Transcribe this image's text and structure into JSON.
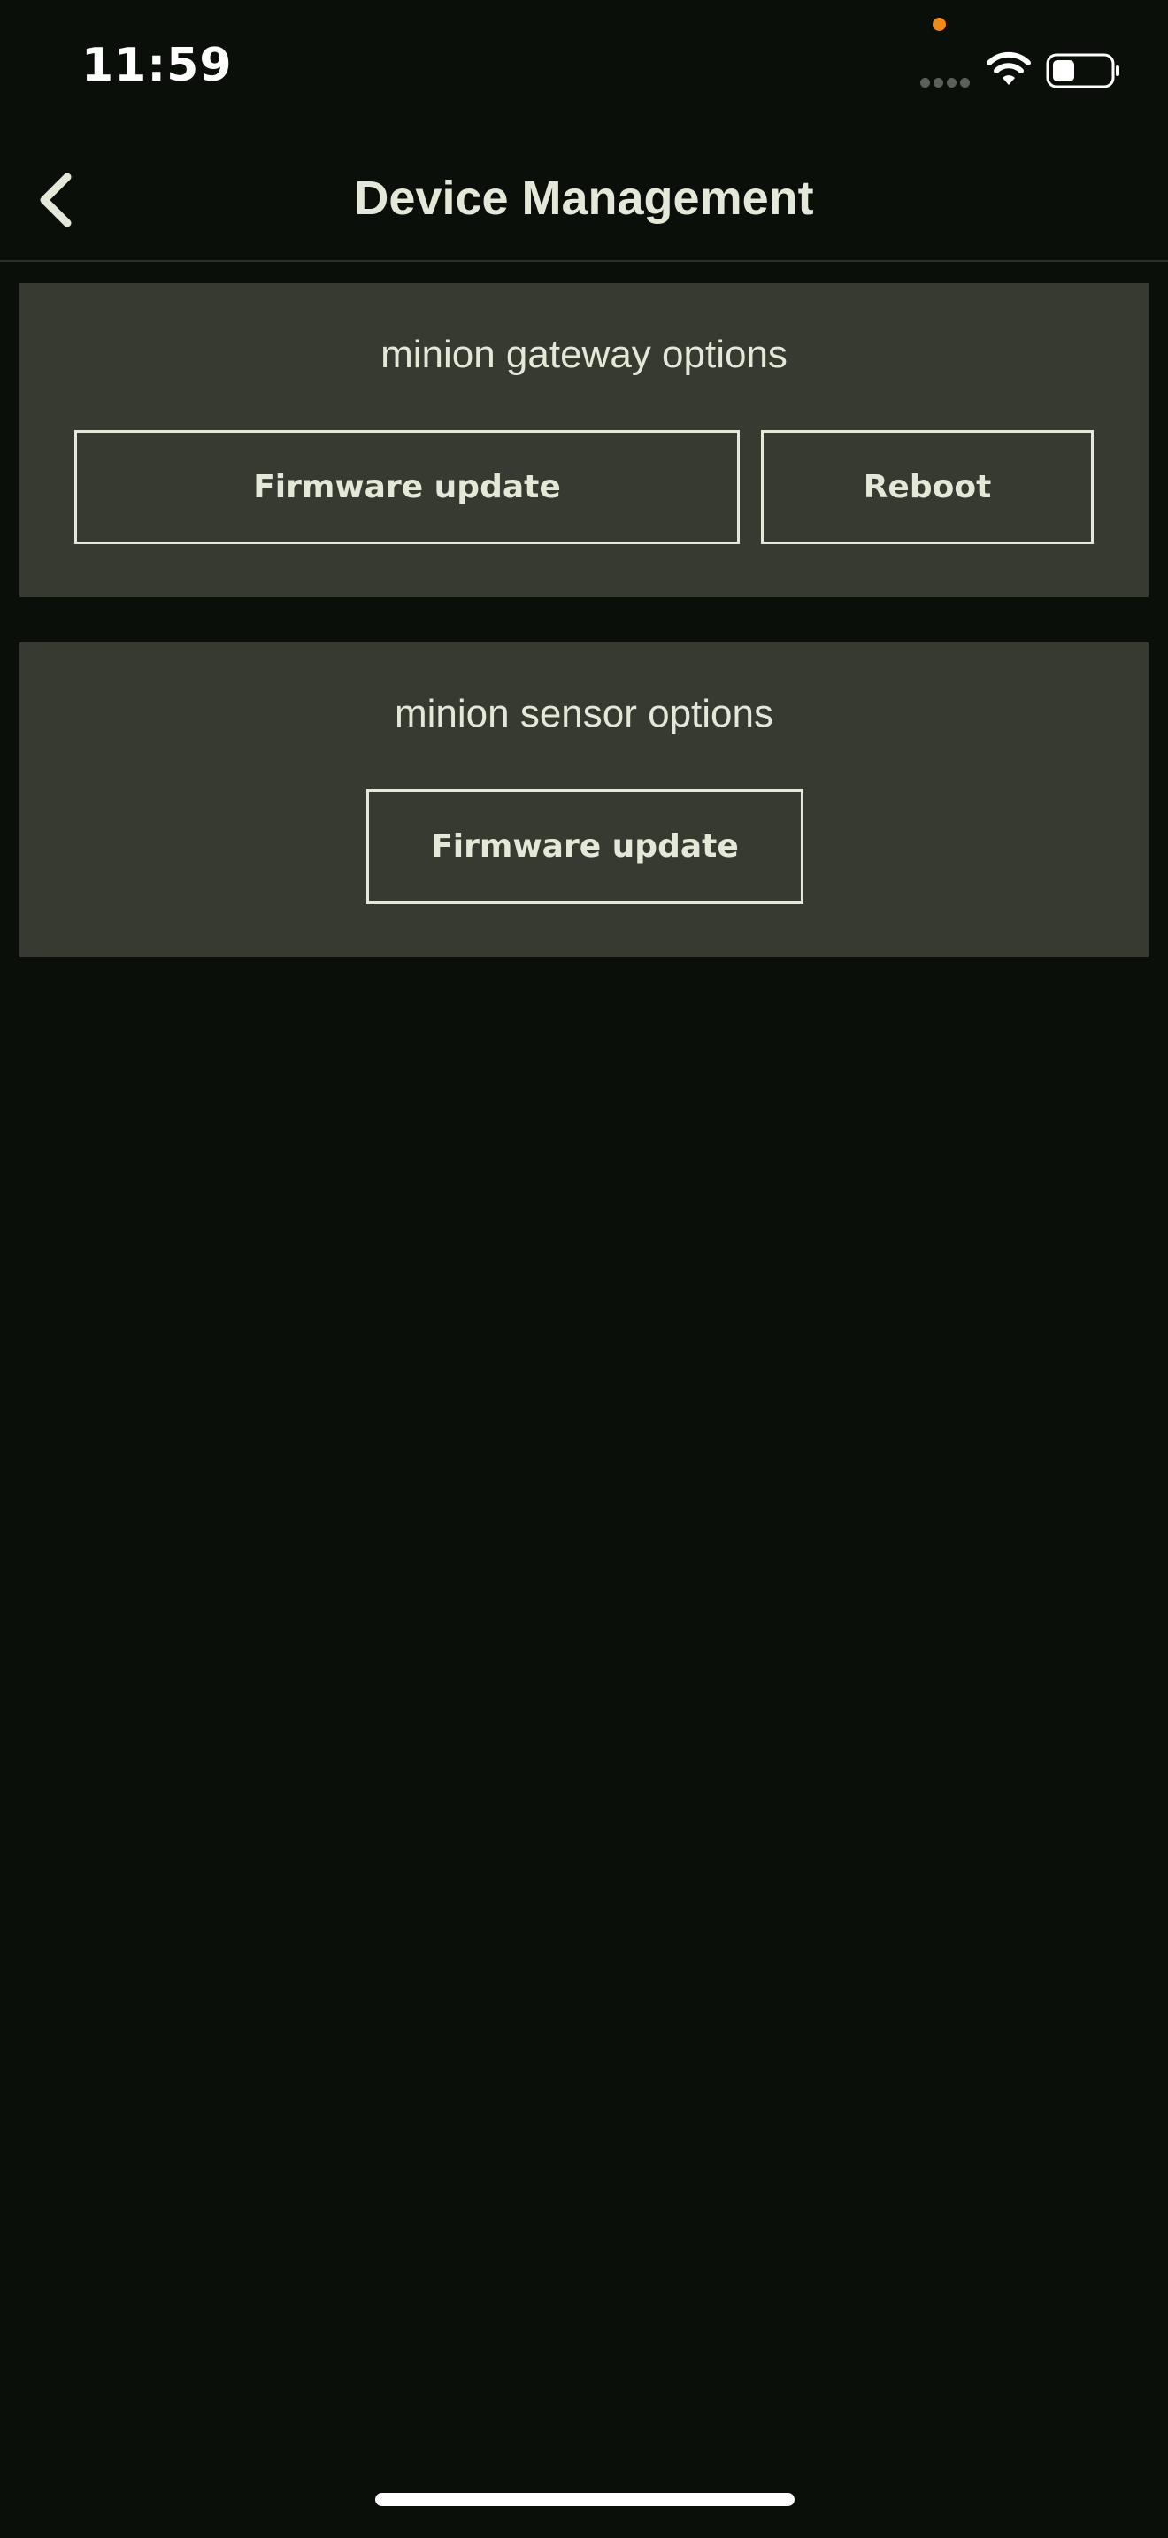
{
  "status_bar": {
    "time": "11:59",
    "icons": [
      "privacy-indicator-dot",
      "cellular-signal-icon",
      "wifi-icon",
      "battery-icon"
    ],
    "privacy_dot_color": "#f08a1d"
  },
  "nav": {
    "back_icon": "chevron-left-icon",
    "title": "Device Management"
  },
  "gateway_section": {
    "title": "minion gateway options",
    "firmware_update_label": "Firmware update",
    "reboot_label": "Reboot"
  },
  "sensor_section": {
    "title": "minion sensor options",
    "firmware_update_label": "Firmware update"
  },
  "colors": {
    "background": "#0b0f09",
    "card": "#363a31",
    "text": "#e4e8d8"
  }
}
